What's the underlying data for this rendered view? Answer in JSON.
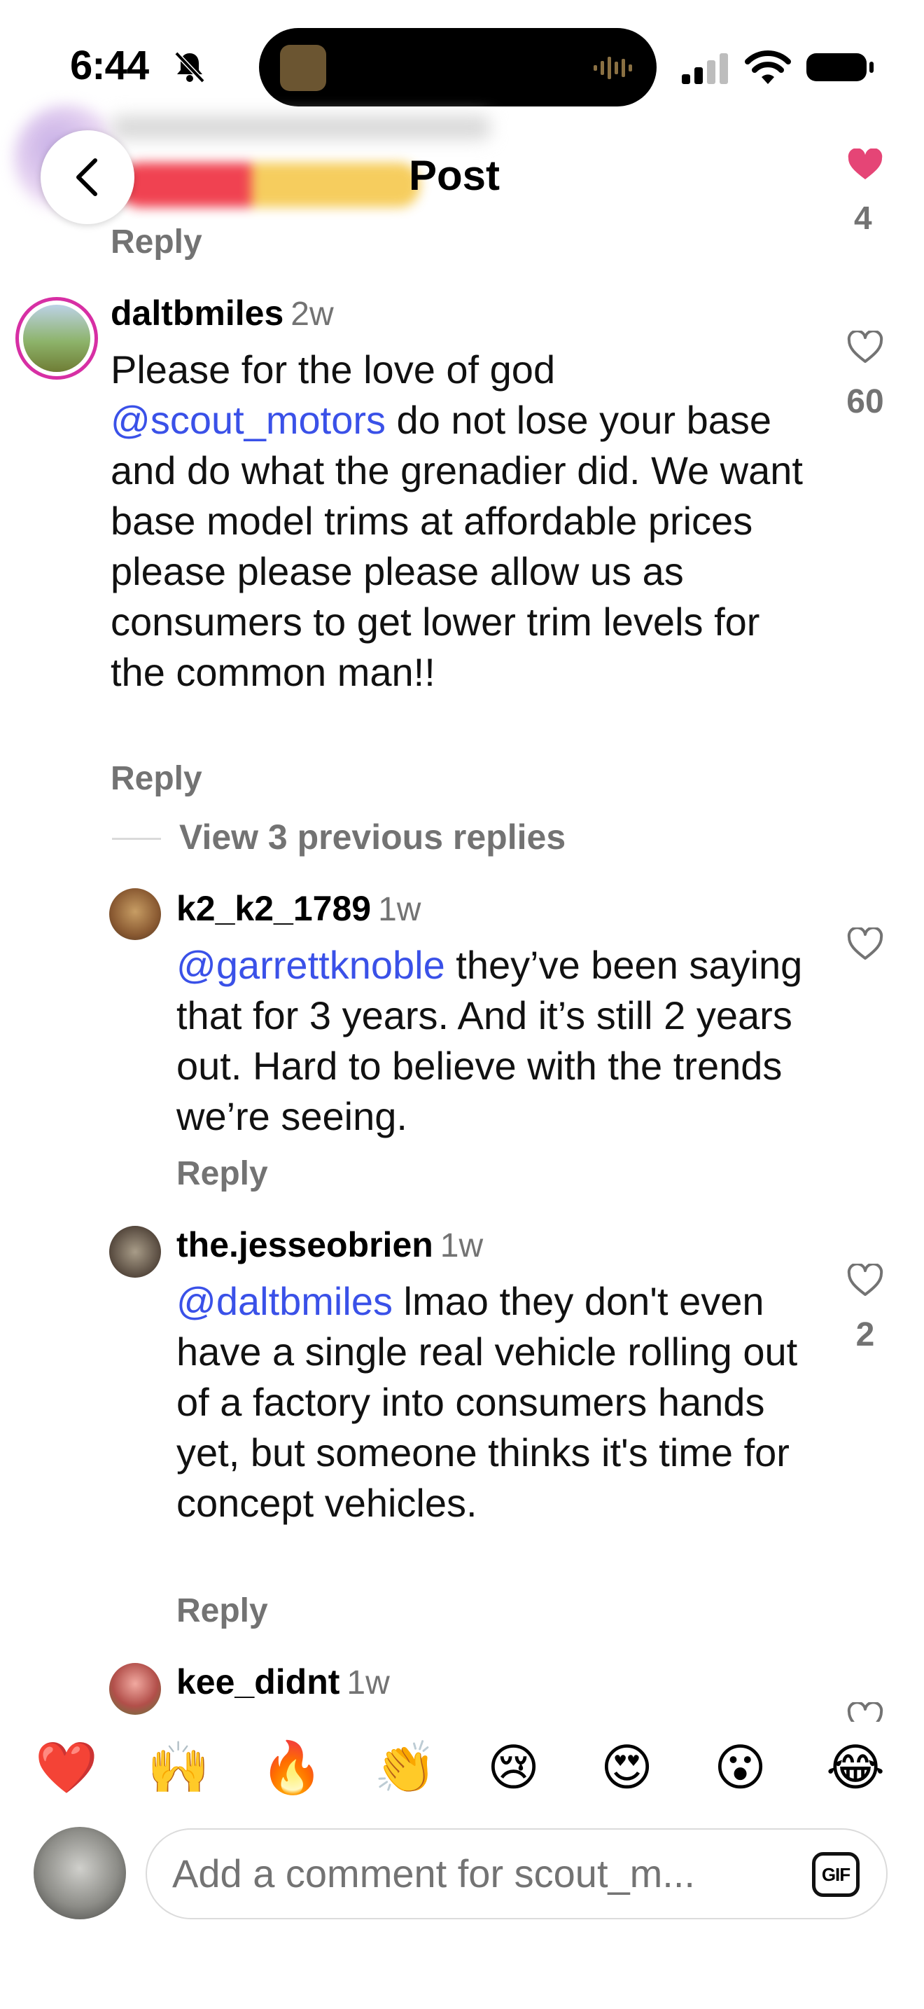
{
  "status_bar": {
    "time": "6:44"
  },
  "header": {
    "title": "Post"
  },
  "top_comment": {
    "reply_label": "Reply",
    "likes": "4"
  },
  "comments": [
    {
      "username": "daltbmiles",
      "age": "2w",
      "mention": "@scout_motors",
      "text_before": "Please for the love of god ",
      "text_after": " do not lose your base and do what the grenadier did. We want base model trims at affordable prices please please please allow us as consumers to get lower trim levels for the common man!!",
      "likes": "60",
      "reply_label": "Reply"
    }
  ],
  "view_previous": "View 3 previous replies",
  "replies": [
    {
      "username": "k2_k2_1789",
      "age": "1w",
      "mention": "@garrettknoble",
      "text": " they’ve been saying that for 3 years.  And it’s still 2 years out.  Hard to believe with the trends we’re seeing.",
      "reply_label": "Reply"
    },
    {
      "username": "the.jesseobrien",
      "age": "1w",
      "mention": "@daltbmiles",
      "text": " lmao they don't even have a single real vehicle rolling out of a factory into consumers hands yet, but someone thinks it's time for concept vehicles.",
      "likes": "2",
      "reply_label": "Reply"
    },
    {
      "username": "kee_didnt",
      "age": "1w"
    }
  ],
  "quick_reactions": [
    "❤️",
    "🙌",
    "🔥",
    "👏",
    "😢",
    "😍",
    "😮",
    "😂"
  ],
  "composer": {
    "placeholder": "Add a comment for scout_m...",
    "gif_label": "GIF"
  },
  "colors": {
    "mention": "#3a51e8",
    "secondary_text": "#737373",
    "liked_heart": "#e0245e"
  }
}
